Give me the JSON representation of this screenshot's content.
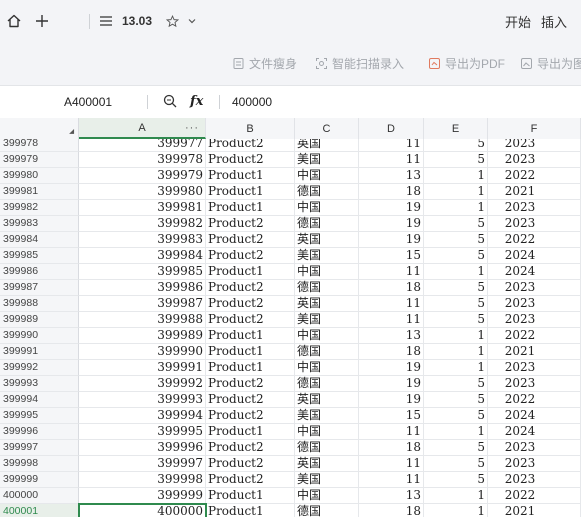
{
  "titlebar": {
    "doc_name": "13.03",
    "menu_start": "开始",
    "menu_insert": "插入"
  },
  "ribbon": {
    "btn_slim": "文件瘦身",
    "btn_scan": "智能扫描录入",
    "btn_pdf": "导出为PDF",
    "btn_export_img": "导出为图"
  },
  "formula_bar": {
    "cell_ref": "A400001",
    "fx_label": "fx",
    "value": "400000"
  },
  "columns": [
    "A",
    "B",
    "C",
    "D",
    "E",
    "F"
  ],
  "col_a_more": "···",
  "rows": [
    {
      "rn": "399978",
      "a": "399977",
      "b": "Product2",
      "c": "英国",
      "d": "11",
      "e": "5",
      "f": "2023"
    },
    {
      "rn": "399979",
      "a": "399978",
      "b": "Product2",
      "c": "美国",
      "d": "11",
      "e": "5",
      "f": "2023"
    },
    {
      "rn": "399980",
      "a": "399979",
      "b": "Product1",
      "c": "中国",
      "d": "13",
      "e": "1",
      "f": "2022"
    },
    {
      "rn": "399981",
      "a": "399980",
      "b": "Product1",
      "c": "德国",
      "d": "18",
      "e": "1",
      "f": "2021"
    },
    {
      "rn": "399982",
      "a": "399981",
      "b": "Product1",
      "c": "中国",
      "d": "19",
      "e": "1",
      "f": "2023"
    },
    {
      "rn": "399983",
      "a": "399982",
      "b": "Product2",
      "c": "德国",
      "d": "19",
      "e": "5",
      "f": "2023"
    },
    {
      "rn": "399984",
      "a": "399983",
      "b": "Product2",
      "c": "英国",
      "d": "19",
      "e": "5",
      "f": "2022"
    },
    {
      "rn": "399985",
      "a": "399984",
      "b": "Product2",
      "c": "美国",
      "d": "15",
      "e": "5",
      "f": "2024"
    },
    {
      "rn": "399986",
      "a": "399985",
      "b": "Product1",
      "c": "中国",
      "d": "11",
      "e": "1",
      "f": "2024"
    },
    {
      "rn": "399987",
      "a": "399986",
      "b": "Product2",
      "c": "德国",
      "d": "18",
      "e": "5",
      "f": "2023"
    },
    {
      "rn": "399988",
      "a": "399987",
      "b": "Product2",
      "c": "英国",
      "d": "11",
      "e": "5",
      "f": "2023"
    },
    {
      "rn": "399989",
      "a": "399988",
      "b": "Product2",
      "c": "美国",
      "d": "11",
      "e": "5",
      "f": "2023"
    },
    {
      "rn": "399990",
      "a": "399989",
      "b": "Product1",
      "c": "中国",
      "d": "13",
      "e": "1",
      "f": "2022"
    },
    {
      "rn": "399991",
      "a": "399990",
      "b": "Product1",
      "c": "德国",
      "d": "18",
      "e": "1",
      "f": "2021"
    },
    {
      "rn": "399992",
      "a": "399991",
      "b": "Product1",
      "c": "中国",
      "d": "19",
      "e": "1",
      "f": "2023"
    },
    {
      "rn": "399993",
      "a": "399992",
      "b": "Product2",
      "c": "德国",
      "d": "19",
      "e": "5",
      "f": "2023"
    },
    {
      "rn": "399994",
      "a": "399993",
      "b": "Product2",
      "c": "英国",
      "d": "19",
      "e": "5",
      "f": "2022"
    },
    {
      "rn": "399995",
      "a": "399994",
      "b": "Product2",
      "c": "美国",
      "d": "15",
      "e": "5",
      "f": "2024"
    },
    {
      "rn": "399996",
      "a": "399995",
      "b": "Product1",
      "c": "中国",
      "d": "11",
      "e": "1",
      "f": "2024"
    },
    {
      "rn": "399997",
      "a": "399996",
      "b": "Product2",
      "c": "德国",
      "d": "18",
      "e": "5",
      "f": "2023"
    },
    {
      "rn": "399998",
      "a": "399997",
      "b": "Product2",
      "c": "英国",
      "d": "11",
      "e": "5",
      "f": "2023"
    },
    {
      "rn": "399999",
      "a": "399998",
      "b": "Product2",
      "c": "美国",
      "d": "11",
      "e": "5",
      "f": "2023"
    },
    {
      "rn": "400000",
      "a": "399999",
      "b": "Product1",
      "c": "中国",
      "d": "13",
      "e": "1",
      "f": "2022"
    },
    {
      "rn": "400001",
      "a": "400000",
      "b": "Product1",
      "c": "德国",
      "d": "18",
      "e": "1",
      "f": "2021"
    }
  ],
  "selected_row": "400001",
  "colors": {
    "accent_green": "#2f8a4e",
    "header_bg": "#f5f6f8"
  }
}
